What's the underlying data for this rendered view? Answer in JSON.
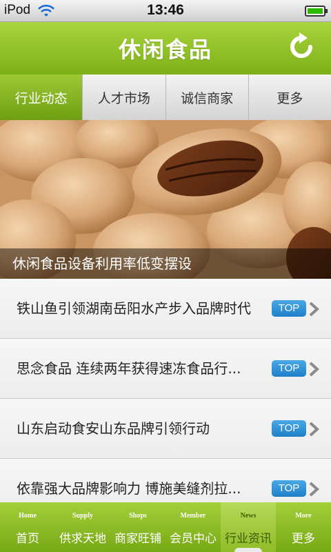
{
  "status_bar": {
    "carrier": "iPod",
    "time": "13:46"
  },
  "header": {
    "title": "休闲食品",
    "refresh_icon": "refresh-icon"
  },
  "tabs": [
    {
      "label": "行业动态",
      "active": true
    },
    {
      "label": "人才市场",
      "active": false
    },
    {
      "label": "诚信商家",
      "active": false
    },
    {
      "label": "更多",
      "active": false
    }
  ],
  "banner": {
    "caption": "休闲食品设备利用率低变摆设"
  },
  "news": [
    {
      "title": "铁山鱼引领湖南岳阳水产步入品牌时代",
      "badge": "TOP"
    },
    {
      "title": "思念食品 连续两年获得速冻食品行...",
      "badge": "TOP"
    },
    {
      "title": "山东启动食安山东品牌引领行动",
      "badge": "TOP"
    },
    {
      "title": "依靠强大品牌影响力 博施美缝剂拉...",
      "badge": "TOP"
    }
  ],
  "bottom_nav": [
    {
      "en": "Home",
      "cn": "首页"
    },
    {
      "en": "Supply",
      "cn": "供求天地"
    },
    {
      "en": "Shops",
      "cn": "商家旺铺"
    },
    {
      "en": "Member",
      "cn": "会员中心"
    },
    {
      "en": "News",
      "cn": "行业资讯",
      "active": true
    },
    {
      "en": "More",
      "cn": "更多"
    }
  ],
  "colors": {
    "brand_green": "#8fbf24",
    "badge_blue": "#2f8fd6"
  }
}
